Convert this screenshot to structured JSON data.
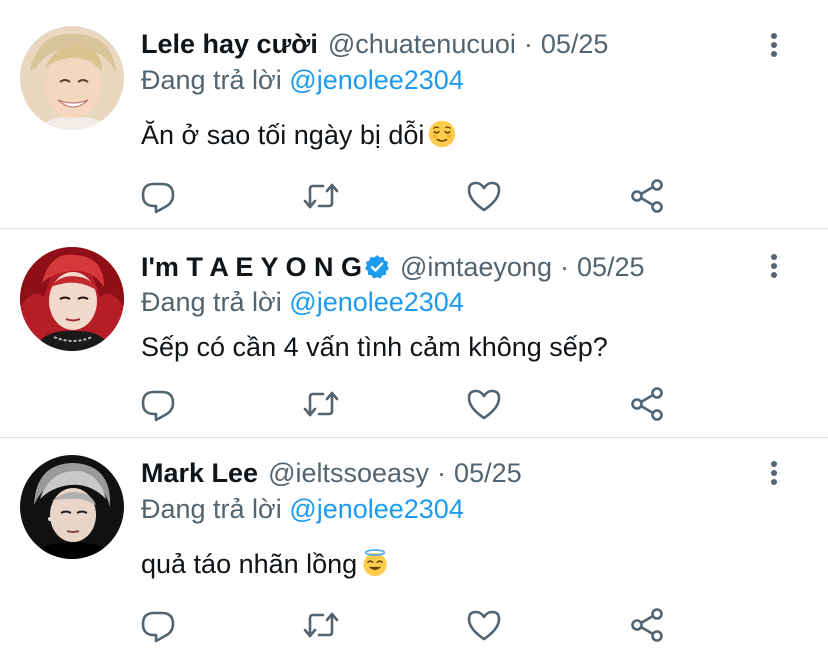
{
  "replying_prefix": "Đang trả lời",
  "tweets": [
    {
      "name": "Lele hay cười",
      "handle": "@chuatenucuoi",
      "separator": "·",
      "date": "05/25",
      "replying_to": "@jenolee2304",
      "text": "Ăn ở sao tối ngày bị dỗi",
      "emoji": "relieved-face",
      "verified": false
    },
    {
      "name": "I'm T A E Y O N G",
      "handle": "@imtaeyong",
      "separator": "·",
      "date": "05/25",
      "replying_to": "@jenolee2304",
      "text": "Sếp có cần 4 vấn tình cảm không sếp?",
      "verified": true
    },
    {
      "name": "Mark Lee",
      "handle": "@ieltssoeasy",
      "separator": "·",
      "date": "05/25",
      "replying_to": "@jenolee2304",
      "text": "quả táo nhãn lồng",
      "emoji": "smiling-face-with-halo",
      "verified": false
    }
  ],
  "actions": [
    "reply-icon",
    "retweet-icon",
    "like-icon",
    "share-icon"
  ],
  "colors": {
    "text": "#0f1419",
    "secondary": "#536471",
    "link": "#1d9bf0",
    "divider": "#dfe3e6",
    "verified": "#1d9bf0"
  }
}
